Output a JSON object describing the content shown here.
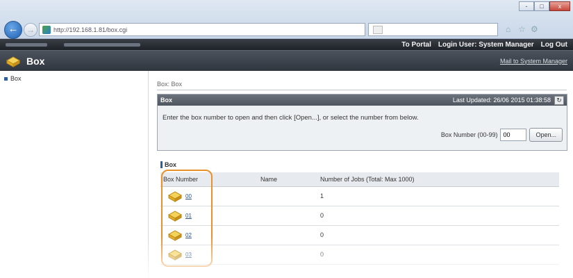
{
  "browser": {
    "address_url": "http://192.168.1.81/box.cgi",
    "tab_title": "",
    "window_controls": [
      "-",
      "□",
      "x"
    ]
  },
  "portal_bar": {
    "to_portal": "To Portal",
    "login_user": "Login User: System Manager",
    "logout": "Log Out"
  },
  "header": {
    "title": "Box",
    "mail_link": "Mail to System Manager"
  },
  "sidebar": {
    "items": [
      {
        "label": "Box"
      }
    ]
  },
  "breadcrumb": "Box: Box",
  "panel": {
    "title": "Box",
    "last_updated": "Last Updated: 26/06 2015 01:38:58",
    "instruction": "Enter the box number to open and then click [Open...], or select the number from below.",
    "box_number_label": "Box Number (00-99)",
    "box_number_value": "00",
    "open_button": "Open..."
  },
  "box_section": {
    "title": "Box",
    "columns": [
      "Box Number",
      "Name",
      "Number of Jobs (Total: Max 1000)"
    ],
    "rows": [
      {
        "number": "00",
        "name": "",
        "jobs": "1"
      },
      {
        "number": "01",
        "name": "",
        "jobs": "0"
      },
      {
        "number": "02",
        "name": "",
        "jobs": "0"
      },
      {
        "number": "03",
        "name": "",
        "jobs": "0"
      }
    ]
  },
  "colors": {
    "highlight": "#e8902a",
    "dark_bar": "#2a2f36",
    "link": "#2a4f8a"
  }
}
